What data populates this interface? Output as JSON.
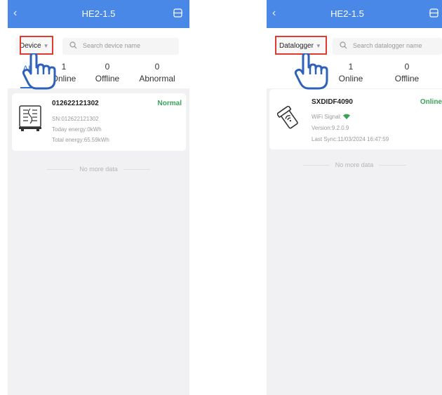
{
  "left": {
    "header": {
      "title": "HE2-1.5"
    },
    "filter": {
      "dropdown_label": "Device",
      "search_placeholder": "Search device name"
    },
    "tabs": [
      {
        "count": "",
        "label": "All"
      },
      {
        "count": "1",
        "label": "Online"
      },
      {
        "count": "0",
        "label": "Offline"
      },
      {
        "count": "0",
        "label": "Abnormal"
      }
    ],
    "card": {
      "name": "012622121302",
      "status": "Normal",
      "sn": "SN:012622121302",
      "today_energy": "Today energy:0kWh",
      "total_energy": "Total energy:65.59kWh"
    },
    "no_more": "No more data"
  },
  "right": {
    "header": {
      "title": "HE2-1.5"
    },
    "filter": {
      "dropdown_label": "Datalogger",
      "search_placeholder": "Search datalogger name"
    },
    "tabs": [
      {
        "count": "1",
        "label": "Online"
      },
      {
        "count": "0",
        "label": "Offline"
      }
    ],
    "card": {
      "name": "SXDIDF4090",
      "status": "Online",
      "wifi_label": "WiFi Signal:",
      "version": "Version:9.2.0.9",
      "last_sync": "Last Sync:11/03/2024 16:47:59"
    },
    "no_more": "No more data"
  },
  "icons": {
    "back": "chevron-left-icon",
    "header_right": "scan-icon",
    "search": "search-icon",
    "dropdown_caret": "caret-down-icon",
    "inverter": "inverter-icon",
    "datalogger": "datalogger-icon",
    "wifi": "wifi-icon",
    "pointer": "pointing-hand-icon"
  },
  "colors": {
    "header_bg": "#4a88e8",
    "accent": "#2e6fd8",
    "status_ok": "#3aa35a",
    "highlight": "#e23a2e"
  }
}
